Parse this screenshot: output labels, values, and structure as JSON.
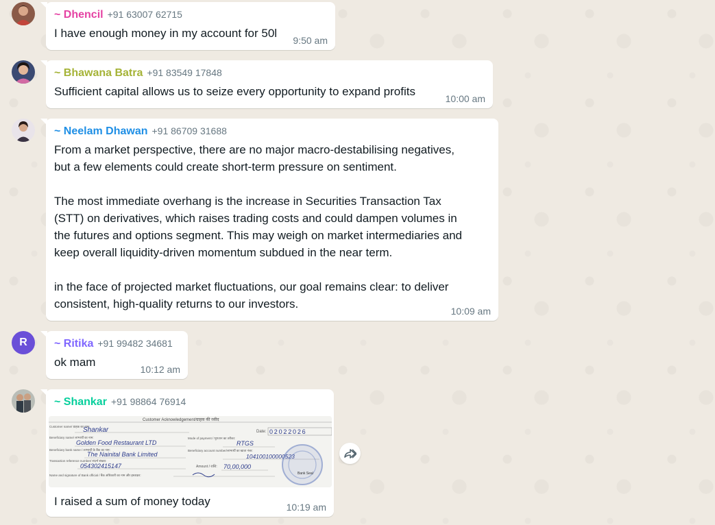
{
  "messages": [
    {
      "sender": "~ Dhencil",
      "phone": "+91 63007 62715",
      "text": "I have enough money in my account for 50l",
      "time": "9:50 am",
      "name_color": "#e542a3"
    },
    {
      "sender": "~ Bhawana Batra",
      "phone": "+91 83549 17848",
      "text": "Sufficient capital allows us to seize every opportunity to expand profits",
      "time": "10:00 am",
      "name_color": "#a5b337"
    },
    {
      "sender": "~ Neelam Dhawan",
      "phone": "+91 86709 31688",
      "text": "From a market perspective, there are no major macro-destabilising negatives,\nbut a few elements could create short-term pressure on sentiment.\n\nThe most immediate overhang is the increase in Securities Transaction Tax\n(STT) on derivatives, which raises trading costs and could dampen volumes in\nthe futures and options segment. This may weigh on market intermediaries and\nkeep overall liquidity-driven momentum subdued in the near term.\n\nin the face of projected market fluctuations, our goal remains clear: to deliver\nconsistent, high-quality returns to our investors.",
      "time": "10:09 am",
      "name_color": "#1f8fe5"
    },
    {
      "sender": "~ Ritika",
      "phone": "+91 99482 34681",
      "text": "ok mam",
      "time": "10:12 am",
      "name_color": "#7f66ff",
      "avatar_initial": "R",
      "avatar_color": "#6a4fd8"
    },
    {
      "sender": "~ Shankar",
      "phone": "+91 98864 76914",
      "text": "I raised a sum of money today",
      "time": "10:19 am",
      "name_color": "#06cf9c"
    }
  ],
  "cheque": {
    "heading": "Customer Acknowledgement/ग्राहक की रसीद",
    "customer_name_label": "Customer name/ ग्राहक का नाम:",
    "customer_name": "Shankar",
    "date_label": "Date:",
    "date": "02022026",
    "beneficiary_name_label": "Beneficiary name/ लाभार्थी का नाम:",
    "beneficiary_name": "Golden Food Restaurant LTD",
    "mode_label": "Mode of payment / भुगतान का तरीका:",
    "mode": "RTGS",
    "bank_label": "Beneficiary bank name / लाभार्थी के बैंक का नाम:",
    "bank_name": "The Nainital Bank Limited",
    "account_label": "Beneficiary account number/लाभार्थी का खाता नंबर:",
    "account_number": "104100100000523",
    "ref_label": "Transaction reference number/ संदर्भ संख्या:",
    "ref_number": "054302415147",
    "amount_label": "Amount / राशि:",
    "amount": "70,00,000",
    "signature_label": "Name and signature of Bank official / बैंक अधिकारी का नाम और हस्ताक्षर:",
    "seal_text": "Bank Seal"
  },
  "colors": {
    "chat_background": "#efeae2",
    "bubble": "#ffffff",
    "meta_text": "#667781"
  }
}
